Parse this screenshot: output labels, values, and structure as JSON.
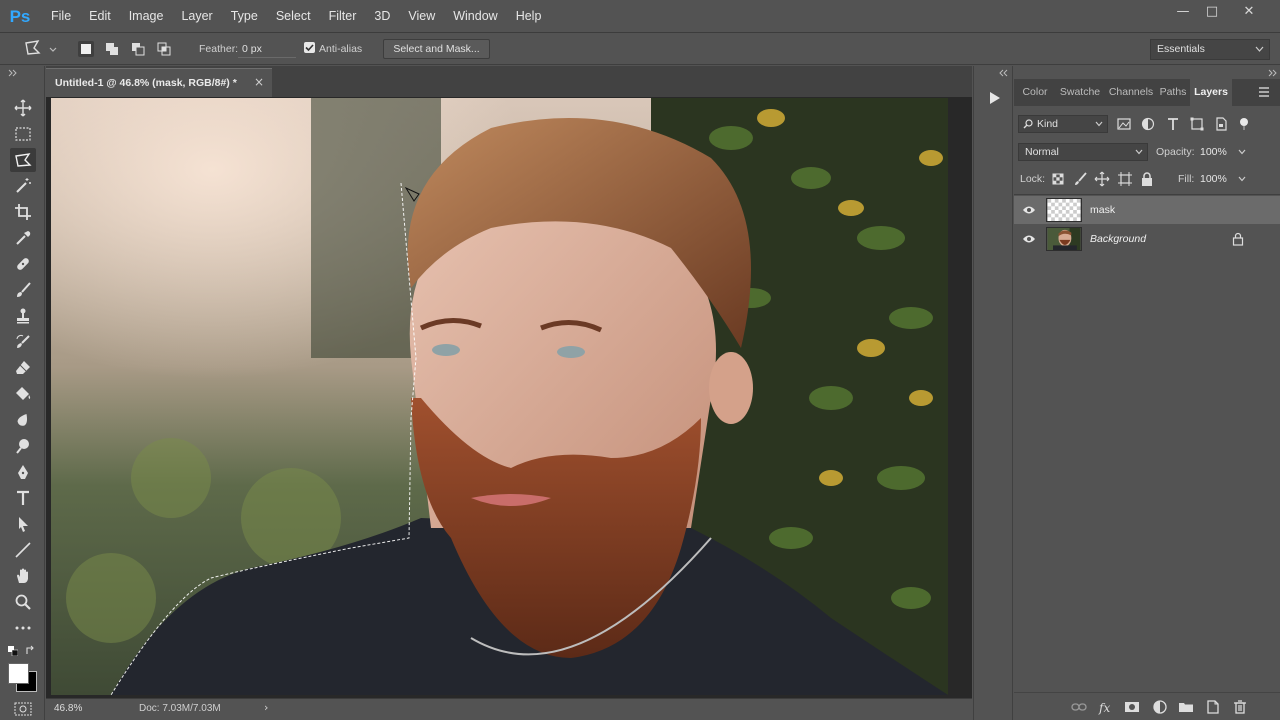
{
  "app": {
    "logo": "Ps"
  },
  "menu": [
    "File",
    "Edit",
    "Image",
    "Layer",
    "Type",
    "Select",
    "Filter",
    "3D",
    "View",
    "Window",
    "Help"
  ],
  "window_controls": {
    "minimize": "—",
    "restore": "□",
    "close": "✕"
  },
  "options": {
    "feather_label": "Feather:",
    "feather_value": "0 px",
    "antialias_label": "Anti-alias",
    "select_mask_label": "Select and Mask...",
    "workspace": "Essentials"
  },
  "document": {
    "tab_title": "Untitled-1 @ 46.8% (mask, RGB/8#) *",
    "close_glyph": "×"
  },
  "status": {
    "zoom": "46.8%",
    "doc_size": "Doc: 7.03M/7.03M",
    "arrow": "›"
  },
  "panel_tabs": [
    "Color",
    "Swatche",
    "Channels",
    "Paths",
    "Layers"
  ],
  "layers_panel": {
    "filter_kind": "Kind",
    "blend_mode": "Normal",
    "opacity_label": "Opacity:",
    "opacity_value": "100%",
    "lock_label": "Lock:",
    "fill_label": "Fill:",
    "fill_value": "100%",
    "layers": [
      {
        "name": "mask",
        "selected": true,
        "locked": false
      },
      {
        "name": "Background",
        "selected": false,
        "locked": true
      }
    ]
  },
  "colors": {
    "ui_bg": "#535353",
    "canvas_bg": "#282828",
    "accent": "#31a8ff",
    "selected_layer": "#6b6b6b"
  },
  "icons": {
    "tools": [
      "move-icon",
      "marquee-icon",
      "lasso-icon",
      "magic-wand-icon",
      "crop-icon",
      "eyedropper-icon",
      "healing-brush-icon",
      "brush-icon",
      "clone-stamp-icon",
      "history-brush-icon",
      "eraser-icon",
      "paint-bucket-icon",
      "blur-icon",
      "dodge-icon",
      "pen-icon",
      "type-icon",
      "path-selection-icon",
      "line-icon",
      "hand-icon",
      "zoom-icon",
      "more-tools-icon"
    ]
  }
}
